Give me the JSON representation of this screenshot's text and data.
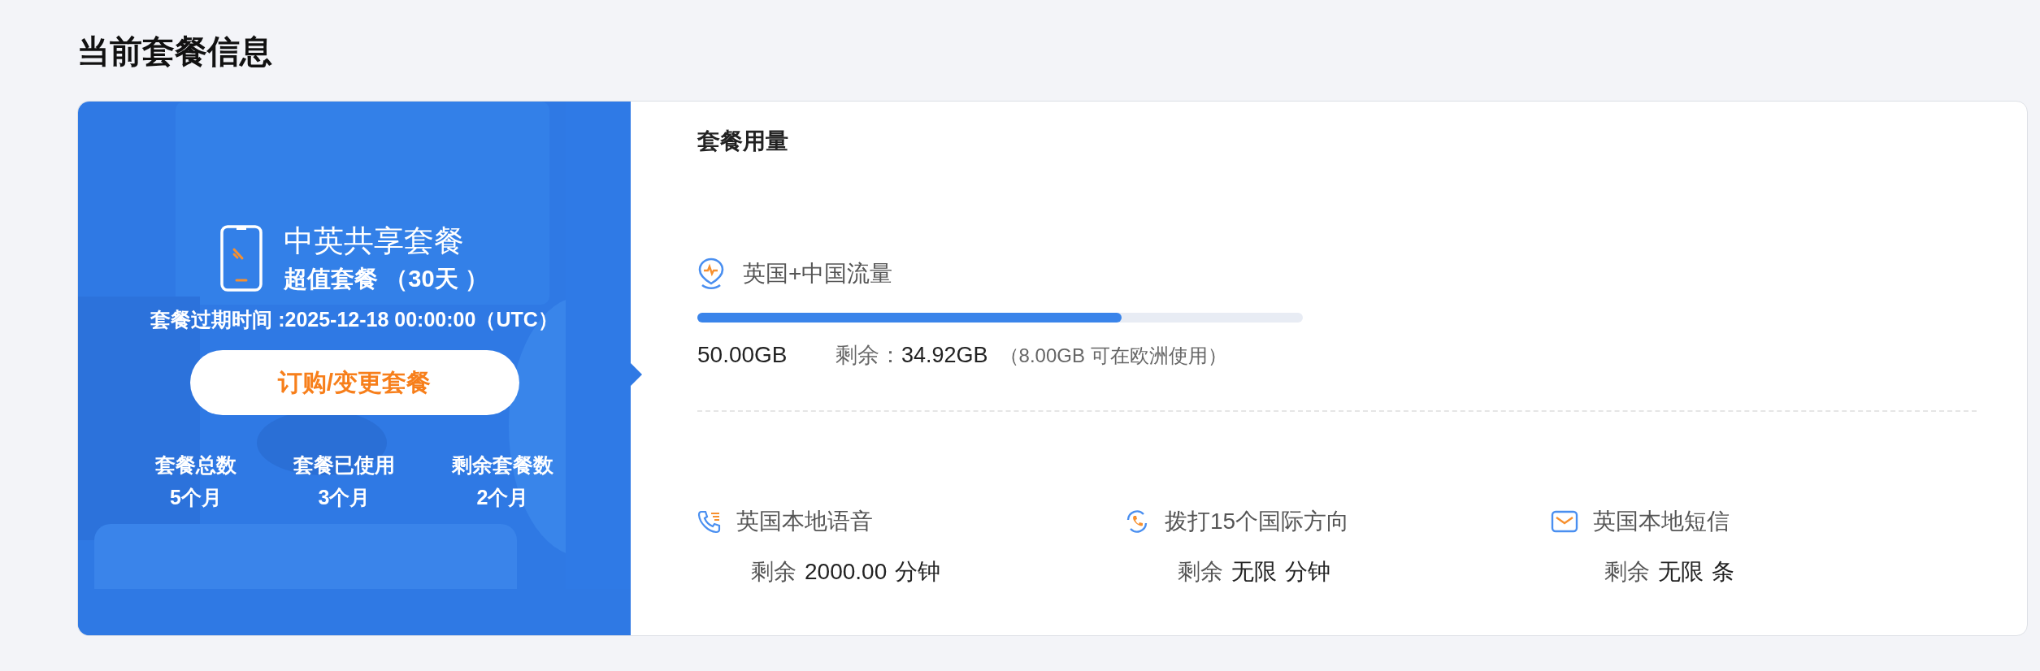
{
  "page_title": "当前套餐信息",
  "plan": {
    "name": "中英共享套餐",
    "subtitle": "超值套餐 （30天 ）",
    "expiry": "套餐过期时间 :2025-12-18 00:00:00（UTC）",
    "button": "订购/变更套餐",
    "stats": [
      {
        "label": "套餐总数",
        "value": "5个月"
      },
      {
        "label": "套餐已使用",
        "value": "3个月"
      },
      {
        "label": "剩余套餐数",
        "value": "2个月"
      }
    ]
  },
  "usage": {
    "title": "套餐用量",
    "data": {
      "label": "英国+中国流量",
      "level": 0.7,
      "total": "50.00GB",
      "remaining_label": "剩余：",
      "remaining_value": "34.92GB",
      "note": "（8.00GB 可在欧洲使用）"
    },
    "items": [
      {
        "kind": "voice",
        "label": "英国本地语音",
        "remaining_label": "剩余",
        "value": "2000.00",
        "unit": "分钟"
      },
      {
        "kind": "intl",
        "label": "拨打15个国际方向",
        "remaining_label": "剩余",
        "value": "无限",
        "unit": "分钟"
      },
      {
        "kind": "sms",
        "label": "英国本地短信",
        "remaining_label": "剩余",
        "value": "无限",
        "unit": "条"
      }
    ]
  }
}
